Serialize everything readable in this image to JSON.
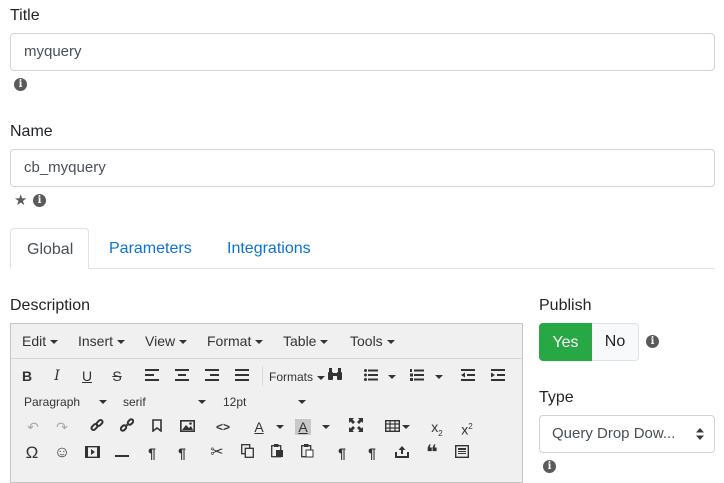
{
  "title_field": {
    "label": "Title",
    "value": "myquery"
  },
  "name_field": {
    "label": "Name",
    "value": "cb_myquery"
  },
  "tabs": [
    {
      "label": "Global",
      "active": true
    },
    {
      "label": "Parameters",
      "active": false
    },
    {
      "label": "Integrations",
      "active": false
    }
  ],
  "description": {
    "label": "Description",
    "menubar": [
      "Edit",
      "Insert",
      "View",
      "Format",
      "Table",
      "Tools"
    ],
    "toolbar": {
      "formats_label": "Formats",
      "block_format": "Paragraph",
      "font_family": "serif",
      "font_size": "12pt",
      "bold": "B",
      "italic": "I",
      "underline": "U",
      "strikethrough": "S",
      "code": "<>",
      "font_color": "A",
      "bg_color": "A",
      "omega": "Ω",
      "pilcrow": "¶"
    }
  },
  "publish": {
    "label": "Publish",
    "yes_label": "Yes",
    "no_label": "No",
    "value": "Yes"
  },
  "type": {
    "label": "Type",
    "selected": "Query Drop Dow..."
  },
  "colors": {
    "success": "#28a745",
    "link": "#0a73d9",
    "icon": "#5a5a5a"
  }
}
